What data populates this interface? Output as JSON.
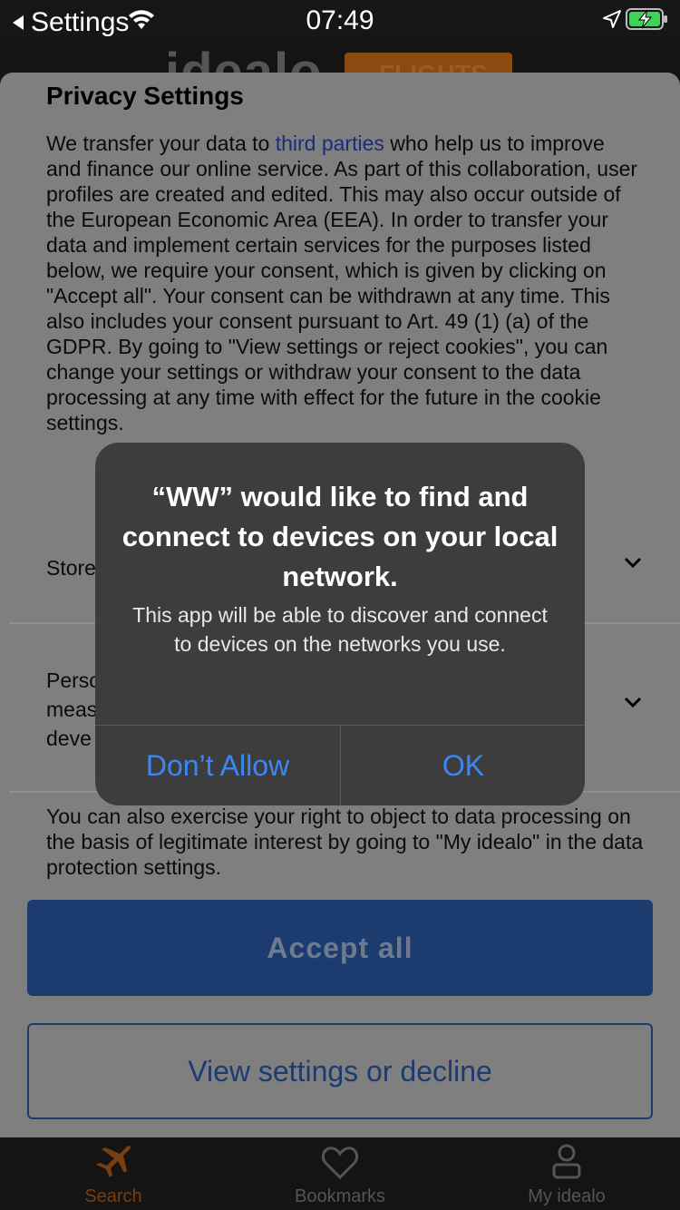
{
  "status_bar": {
    "back_label": "Settings",
    "time": "07:49"
  },
  "app": {
    "logo_text": "idealo",
    "badge_text": "FLIGHTS",
    "tabs": [
      {
        "label": "Search",
        "icon": "airplane-icon",
        "active": true
      },
      {
        "label": "Bookmarks",
        "icon": "heart-icon",
        "active": false
      },
      {
        "label": "My idealo",
        "icon": "person-icon",
        "active": false
      }
    ]
  },
  "privacy": {
    "title": "Privacy Settings",
    "body_before_link": "We transfer your data to ",
    "body_link": "third parties",
    "body_after_link": " who help us to improve and finance our online service. As part of this collaboration, user profiles are created and edited. This may also occur outside of the European Economic Area (EEA). In order to transfer your data and implement certain services for the purposes listed below, we require your consent, which is given by clicking on \"Accept all\". Your consent can be withdrawn at any time. This also includes your consent pursuant to Art. 49 (1) (a) of the GDPR. By going to \"View settings or reject cookies\", you can change your settings or withdraw your consent to the data processing at any time with effect for the future in the cookie settings.",
    "row_store": "Store",
    "row_personal": "Perso\nmeas\ndeve",
    "footer": "You can also exercise your right to object to data processing on the basis of legitimate interest by going to \"My idealo\" in the data protection settings.",
    "accept_label": "Accept all",
    "view_label": "View settings or decline"
  },
  "alert": {
    "title": "“WW” would like to find and connect to devices on your local network.",
    "message": "This app will be able to discover and connect to devices on the networks you use.",
    "deny_label": "Don’t Allow",
    "ok_label": "OK"
  },
  "colors": {
    "accent": "#3b88f5",
    "primary": "#1c3b6f",
    "alert_bg": "#3d3d3d"
  }
}
